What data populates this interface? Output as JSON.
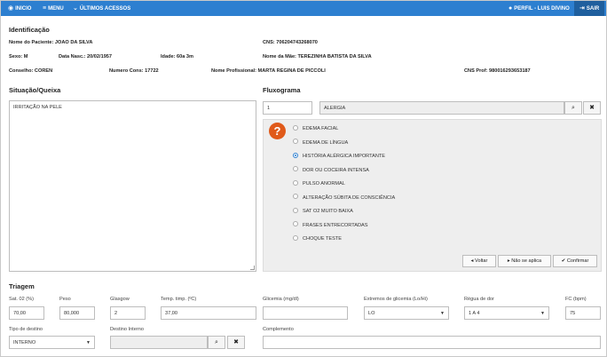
{
  "topbar": {
    "inicio": "INICIO",
    "menu": "MENU",
    "ultimos": "ÚLTIMOS ACESSOS",
    "perfil": "PERFIL - LUIS DIVINO",
    "sair": "SAIR"
  },
  "identificacao": {
    "title": "Identificação",
    "nome_paciente_label": "Nome do Paciente:",
    "nome_paciente": "JOAO DA SILVA",
    "cns_label": "CNS:",
    "cns": "706204743268070",
    "sexo_label": "Sexo:",
    "sexo": "M",
    "nasc_label": "Data Nasc.:",
    "nasc": "20/02/1957",
    "idade_label": "Idade:",
    "idade": "60a 3m",
    "mae_label": "Nome da Mãe:",
    "mae": "TEREZINHA BATISTA DA SILVA",
    "conselho_label": "Conselho:",
    "conselho": "COREN",
    "numcons_label": "Numero Cons:",
    "numcons": "17722",
    "prof_label": "Nome Profissional:",
    "prof": "MARTA REGINA DE PICCOLI",
    "cnsprof_label": "CNS Prof:",
    "cnsprof": "980016293653187"
  },
  "situacao": {
    "title": "Situação/Queixa",
    "text": "IRRITAÇÃO NA PELE"
  },
  "fluxograma": {
    "title": "Fluxograma",
    "code": "1",
    "name": "ALERGIA",
    "options": [
      {
        "label": "EDEMA FACIAL",
        "selected": false
      },
      {
        "label": "EDEMA DE LÍNGUA",
        "selected": false
      },
      {
        "label": "HISTÓRIA ALÉRGICA IMPORTANTE",
        "selected": true
      },
      {
        "label": "DOR OU COCEIRA INTENSA",
        "selected": false
      },
      {
        "label": "PULSO ANORMAL",
        "selected": false
      },
      {
        "label": "ALTERAÇÃO SÚBITA DE CONSCIÊNCIA",
        "selected": false
      },
      {
        "label": "SAT O2 MUITO BAIXA",
        "selected": false
      },
      {
        "label": "FRASES ENTRECORTADAS",
        "selected": false
      },
      {
        "label": "CHOQUE TESTE",
        "selected": false
      }
    ],
    "voltar": "Voltar",
    "nao_aplica": "Não se aplica",
    "confirmar": "Confirmar"
  },
  "triagem": {
    "title": "Triagem",
    "sat_label": "Sat. 02 (%)",
    "sat": "70,00",
    "peso_label": "Peso",
    "peso": "80,000",
    "glasgow_label": "Glasgow",
    "glasgow": "2",
    "temp_label": "Temp. timp. (ºC)",
    "temp": "37,00",
    "glicemia_label": "Glicemia (mg/dl)",
    "glicemia": "",
    "extremos_label": "Extremos de glicemia (Lo/Hi)",
    "extremos": "LO",
    "regua_label": "Régua de dor",
    "regua": "1 A 4",
    "fc_label": "FC (bpm)",
    "fc": "75",
    "destino_label": "Tipo de destino",
    "destino": "INTERNO",
    "destino_interno_label": "Destino Interno",
    "destino_interno": "",
    "complemento_label": "Complemento",
    "complemento": ""
  }
}
